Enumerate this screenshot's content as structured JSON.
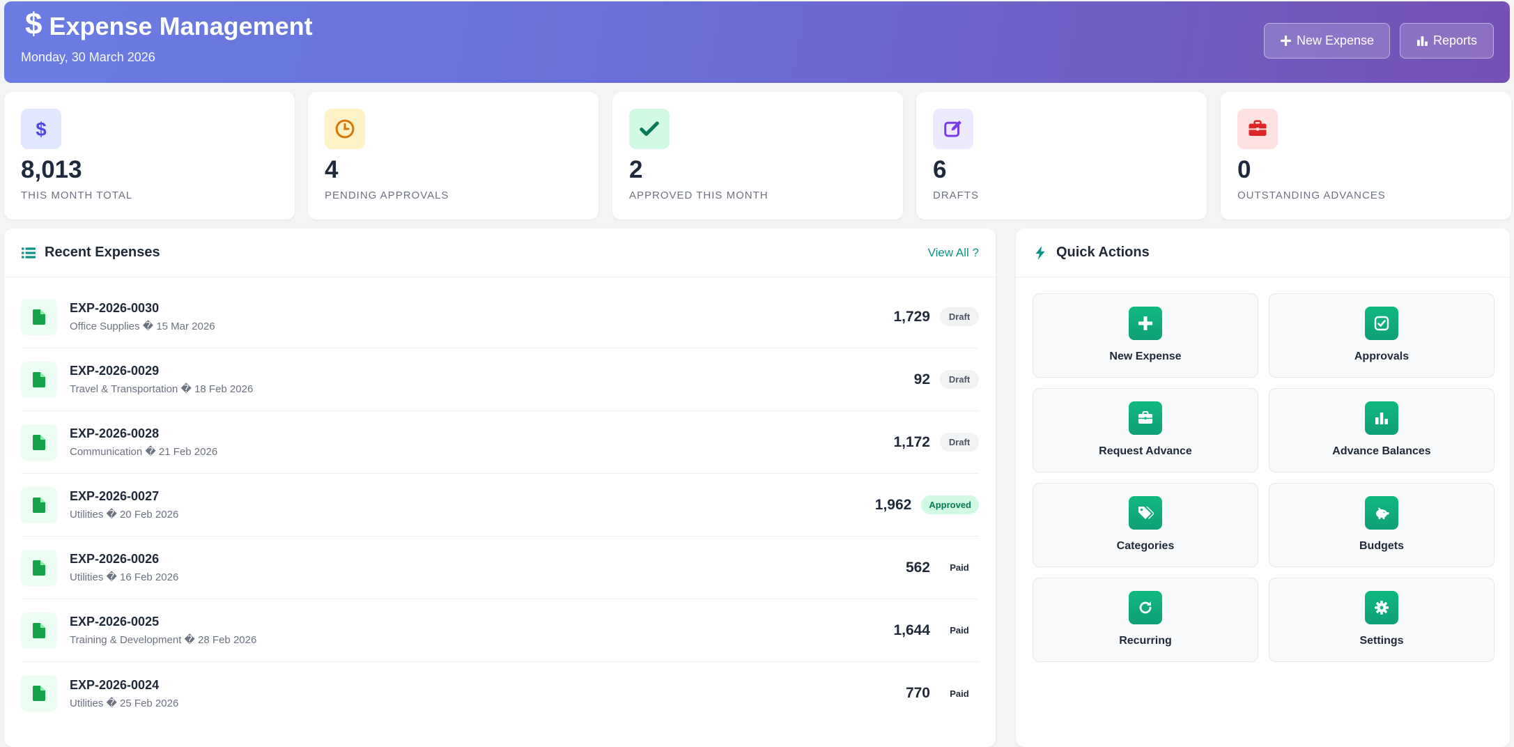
{
  "header": {
    "title": "Expense Management",
    "dollar_glyph": "$",
    "date": "Monday, 30 March 2026",
    "new_expense_label": "New Expense",
    "reports_label": "Reports",
    "gradient_start": "#6a7de3",
    "gradient_end": "#7550b4"
  },
  "stats": [
    {
      "value": "8,013",
      "label": "THIS MONTH TOTAL",
      "icon": "dollar-icon",
      "bg": "#e0e7ff",
      "fg": "#4f46e5"
    },
    {
      "value": "4",
      "label": "PENDING APPROVALS",
      "icon": "clock-icon",
      "bg": "#fef3c7",
      "fg": "#d97706"
    },
    {
      "value": "2",
      "label": "APPROVED THIS MONTH",
      "icon": "check-icon",
      "bg": "#d1fae5",
      "fg": "#047857"
    },
    {
      "value": "6",
      "label": "DRAFTS",
      "icon": "edit-icon",
      "bg": "#ede9fe",
      "fg": "#7c3aed"
    },
    {
      "value": "0",
      "label": "OUTSTANDING ADVANCES",
      "icon": "briefcase-icon",
      "bg": "#fee2e2",
      "fg": "#dc2626"
    }
  ],
  "recent": {
    "title": "Recent Expenses",
    "view_all": "View All ?",
    "items": [
      {
        "number": "EXP-2026-0030",
        "detail": "Office Supplies � 15 Mar 2026",
        "amount": "1,729",
        "status": "Draft"
      },
      {
        "number": "EXP-2026-0029",
        "detail": "Travel & Transportation � 18 Feb 2026",
        "amount": "92",
        "status": "Draft"
      },
      {
        "number": "EXP-2026-0028",
        "detail": "Communication � 21 Feb 2026",
        "amount": "1,172",
        "status": "Draft"
      },
      {
        "number": "EXP-2026-0027",
        "detail": "Utilities � 20 Feb 2026",
        "amount": "1,962",
        "status": "Approved"
      },
      {
        "number": "EXP-2026-0026",
        "detail": "Utilities � 16 Feb 2026",
        "amount": "562",
        "status": "Paid"
      },
      {
        "number": "EXP-2026-0025",
        "detail": "Training & Development � 28 Feb 2026",
        "amount": "1,644",
        "status": "Paid"
      },
      {
        "number": "EXP-2026-0024",
        "detail": "Utilities � 25 Feb 2026",
        "amount": "770",
        "status": "Paid"
      }
    ]
  },
  "quick": {
    "title": "Quick Actions",
    "actions": [
      {
        "label": "New Expense",
        "icon": "plus-icon"
      },
      {
        "label": "Approvals",
        "icon": "check-square-icon"
      },
      {
        "label": "Request Advance",
        "icon": "briefcase-icon"
      },
      {
        "label": "Advance Balances",
        "icon": "bar-chart-icon"
      },
      {
        "label": "Categories",
        "icon": "tags-icon"
      },
      {
        "label": "Budgets",
        "icon": "piggy-bank-icon"
      },
      {
        "label": "Recurring",
        "icon": "refresh-icon"
      },
      {
        "label": "Settings",
        "icon": "gear-icon"
      }
    ]
  },
  "colors": {
    "accent_teal": "#0d9488",
    "action_green": "#10b981"
  }
}
